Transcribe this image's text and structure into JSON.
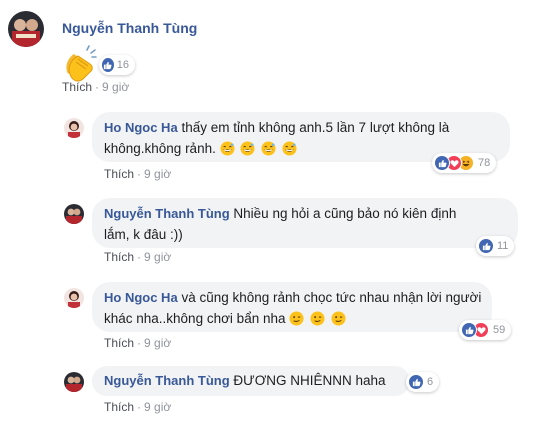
{
  "colors": {
    "name_blue": "#385898",
    "like_blue": "#4267b2",
    "love_red": "#f33e58",
    "haha_yellow": "#f7b125",
    "bubble_gray": "#f2f3f5",
    "meta_gray": "#90949c"
  },
  "top_post": {
    "author": "Nguyễn Thanh Tùng",
    "content_icon": "clapping-hands-icon",
    "reaction_count": "16",
    "like_label": "Thích",
    "time": "9 giờ"
  },
  "replies": [
    {
      "author": "Ho Ngoc Ha",
      "line1": "thấy em tỉnh không anh.5 lần 7 lượt không là",
      "line2": "không.không rảnh.",
      "trailing_emoji": "grinning-sweat-icon",
      "reactions": [
        "like-icon",
        "love-icon",
        "haha-icon"
      ],
      "reaction_count": "78",
      "like_label": "Thích",
      "time": "9 giờ"
    },
    {
      "author": "Nguyễn Thanh Tùng",
      "line1": "Nhiều ng hỏi a cũng bảo nó kiên định",
      "line2": "lắm, k đâu :))",
      "reactions": [
        "like-icon"
      ],
      "reaction_count": "11",
      "like_label": "Thích",
      "time": "9 giờ"
    },
    {
      "author": "Ho Ngoc Ha",
      "line1": "và cũng không rảnh chọc tức nhau nhận lời người",
      "line2": "khác nha..không chơi bẩn nha",
      "trailing_emoji": "wink-icon",
      "reactions": [
        "like-icon",
        "love-icon"
      ],
      "reaction_count": "59",
      "like_label": "Thích",
      "time": "9 giờ"
    },
    {
      "author": "Nguyễn Thanh Tùng",
      "line1": "ĐƯƠNG NHIÊNNN haha",
      "reactions": [
        "like-icon"
      ],
      "reaction_count": "6",
      "like_label": "Thích",
      "time": "9 giờ"
    }
  ]
}
